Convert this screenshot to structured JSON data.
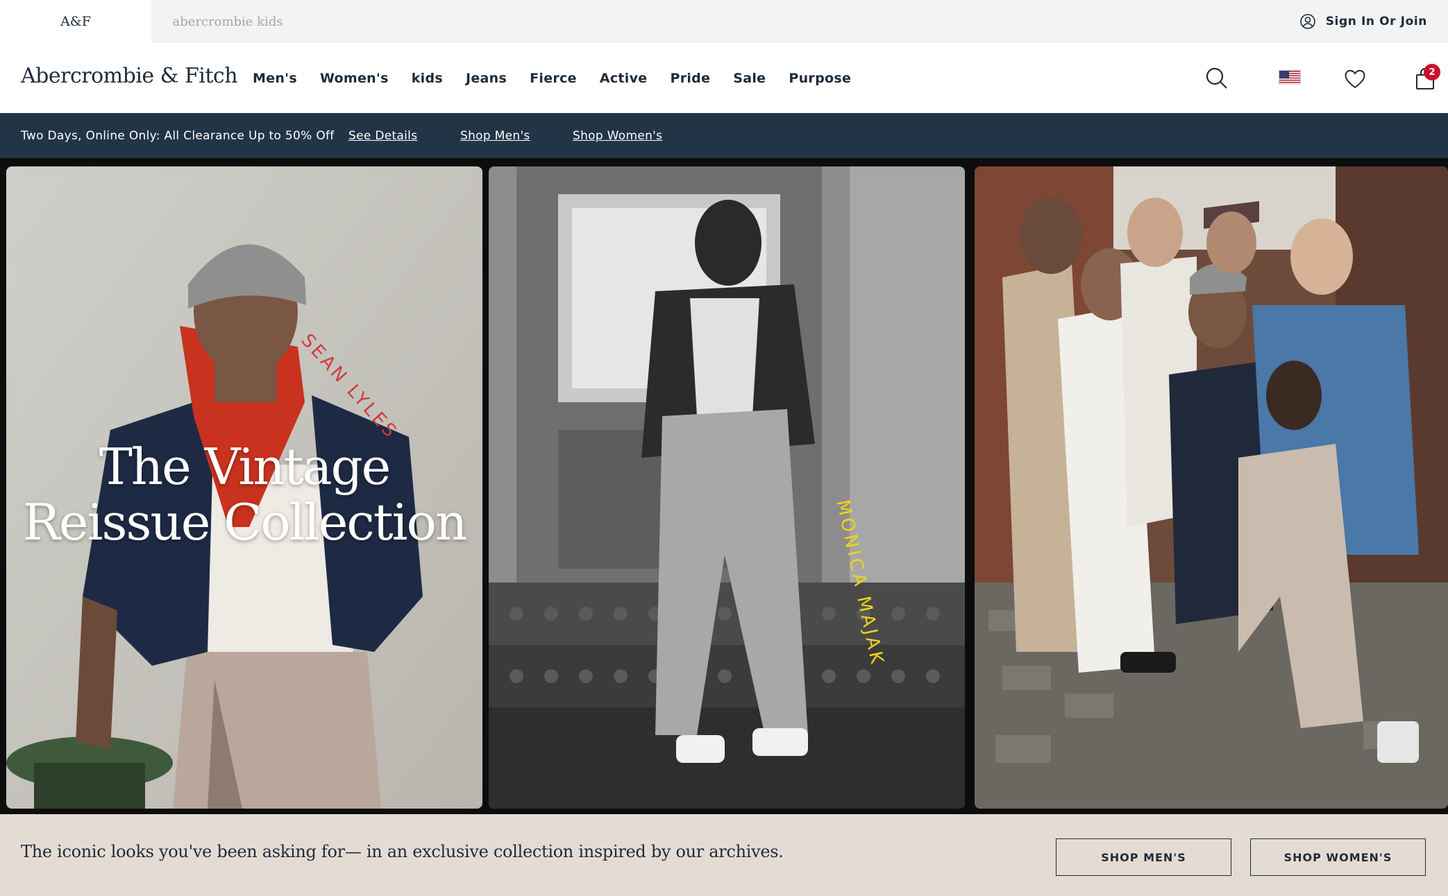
{
  "brand_tabs": [
    {
      "label": "A&F"
    },
    {
      "label": "abercrombie kids"
    }
  ],
  "account": {
    "label": "Sign In Or Join"
  },
  "logo": {
    "text": "Abercrombie & Fitch"
  },
  "nav": {
    "items": [
      "Men's",
      "Women's",
      "kids",
      "Jeans",
      "Fierce",
      "Active",
      "Pride",
      "Sale",
      "Purpose"
    ]
  },
  "header_icons": {
    "search": "search-icon",
    "region": "us-flag-icon",
    "wishlist": "heart-icon",
    "bag": "shopping-bag-icon",
    "bag_count": "2"
  },
  "promo": {
    "text": "Two Days, Online Only: All Clearance Up to 50% Off",
    "links": [
      "See Details",
      "Shop Men's",
      "Shop Women's"
    ]
  },
  "hero": {
    "title_line1": "The Vintage",
    "title_line2": "Reissue Collection",
    "signature_1": "SEAN LYLES",
    "signature_2": "MONICA MAJAK"
  },
  "bottom": {
    "tagline": "The iconic looks you've been asking for— in an exclusive collection inspired by our archives.",
    "cta_men": "SHOP MEN'S",
    "cta_women": "SHOP WOMEN'S"
  },
  "colors": {
    "navy": "#1d2b3a",
    "promo_bg": "#223547",
    "badge": "#c8102e",
    "bottom_bg": "#e4dcd3"
  }
}
